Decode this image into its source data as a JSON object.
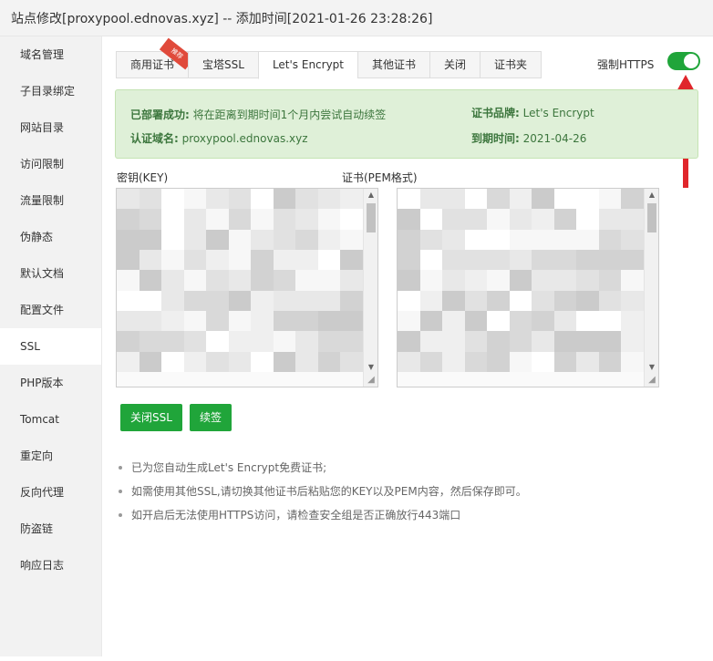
{
  "window": {
    "title": "站点修改[proxypool.ednovas.xyz] -- 添加时间[2021-01-26 23:28:26]"
  },
  "sidebar": {
    "items": [
      {
        "label": "域名管理"
      },
      {
        "label": "子目录绑定"
      },
      {
        "label": "网站目录"
      },
      {
        "label": "访问限制"
      },
      {
        "label": "流量限制"
      },
      {
        "label": "伪静态"
      },
      {
        "label": "默认文档"
      },
      {
        "label": "配置文件"
      },
      {
        "label": "SSL",
        "active": true
      },
      {
        "label": "PHP版本"
      },
      {
        "label": "Tomcat"
      },
      {
        "label": "重定向"
      },
      {
        "label": "反向代理"
      },
      {
        "label": "防盗链"
      },
      {
        "label": "响应日志"
      }
    ]
  },
  "tabs": [
    {
      "label": "商用证书",
      "badge": "推荐"
    },
    {
      "label": "宝塔SSL"
    },
    {
      "label": "Let's Encrypt",
      "active": true
    },
    {
      "label": "其他证书"
    },
    {
      "label": "关闭"
    },
    {
      "label": "证书夹"
    }
  ],
  "https": {
    "label": "强制HTTPS",
    "enabled": true
  },
  "status": {
    "deployed_key": "已部署成功:",
    "deployed_val": "将在距离到期时间1个月内尝试自动续签",
    "domain_key": "认证域名:",
    "domain_val": "proxypool.ednovas.xyz",
    "brand_key": "证书品牌:",
    "brand_val": "Let's Encrypt",
    "expire_key": "到期时间:",
    "expire_val": "2021-04-26"
  },
  "fields": {
    "key_label": "密钥(KEY)",
    "cert_label": "证书(PEM格式)"
  },
  "buttons": {
    "close_ssl": "关闭SSL",
    "renew": "续签"
  },
  "notes": [
    "已为您自动生成Let's Encrypt免费证书;",
    "如需使用其他SSL,请切换其他证书后粘贴您的KEY以及PEM内容，然后保存即可。",
    "如开启后无法使用HTTPS访问，请检查安全组是否正确放行443端口"
  ],
  "colors": {
    "accent": "#20a53a",
    "alert_bg": "#dff0d8",
    "alert_text": "#3c763d",
    "arrow": "#e0262b",
    "badge": "#e04a3b"
  },
  "icons": {
    "toggle": "toggle-switch-icon",
    "arrow": "red-arrow-icon"
  }
}
